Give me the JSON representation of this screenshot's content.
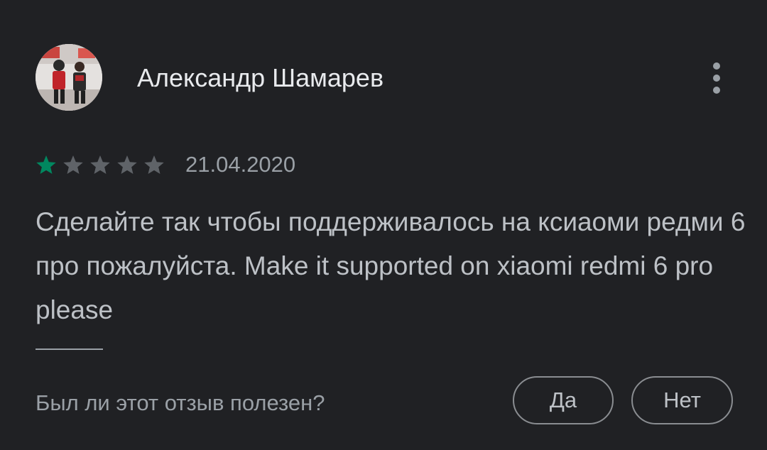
{
  "review": {
    "author_name": "Александр Шамарев",
    "avatar": "profile-photo",
    "menu_icon": "more-vert-icon",
    "rating": {
      "value": 1,
      "max": 5,
      "filled_color": "#01875f",
      "empty_color": "#5f6368"
    },
    "date": "21.04.2020",
    "text": "Сделайте так чтобы поддерживалось на ксиаоми редми 6 про пожалуйста. Make it supported on xiaomi redmi 6 pro please"
  },
  "feedback": {
    "question": "Был ли этот отзыв полезен?",
    "yes_label": "Да",
    "no_label": "Нет"
  }
}
